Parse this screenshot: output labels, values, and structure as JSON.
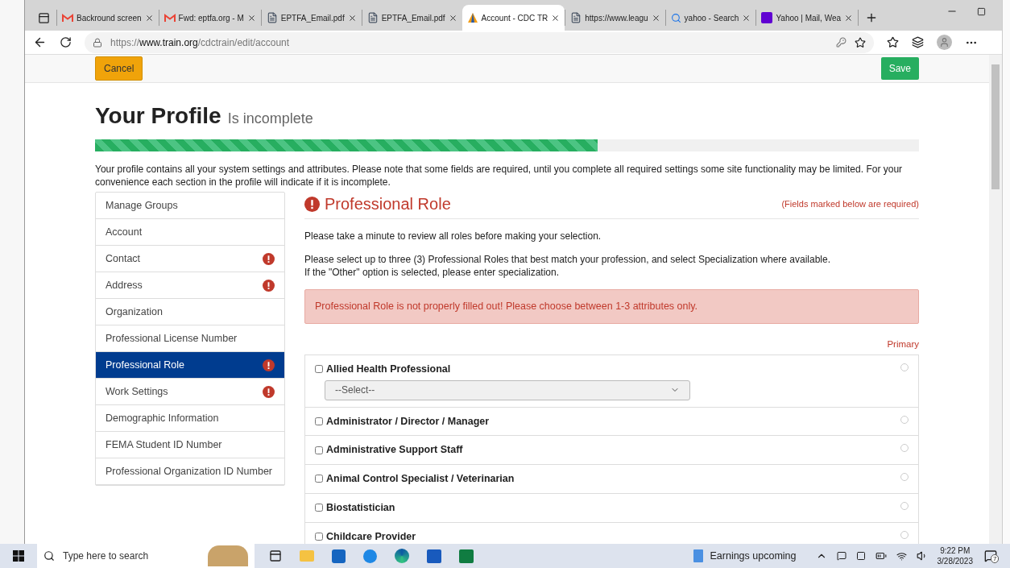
{
  "browser": {
    "tabs": [
      {
        "title": "Backround screen",
        "kind": "gmail",
        "selected": false
      },
      {
        "title": "Fwd: eptfa.org - M",
        "kind": "gmail",
        "selected": false
      },
      {
        "title": "EPTFA_Email.pdf",
        "kind": "doc",
        "selected": false
      },
      {
        "title": "EPTFA_Email.pdf",
        "kind": "doc",
        "selected": false
      },
      {
        "title": "Account - CDC TR",
        "kind": "cdc",
        "selected": true
      },
      {
        "title": "https://www.leagu",
        "kind": "doc",
        "selected": false
      },
      {
        "title": "yahoo - Search",
        "kind": "search",
        "selected": false
      },
      {
        "title": "Yahoo | Mail, Wea",
        "kind": "yahoo",
        "selected": false
      }
    ],
    "url": {
      "scheme": "https://",
      "host": "www.train.org",
      "path": "/cdctrain/edit/account"
    }
  },
  "page": {
    "cancel": "Cancel",
    "save": "Save",
    "title": "Your Profile",
    "status": "Is incomplete",
    "progress": {
      "level": 0.61
    },
    "intro": "Your profile contains all your system settings and attributes. Please note that some fields are required, until you complete all required settings some site functionality may be limited. For your convenience each section in the profile will indicate if it is incomplete.",
    "sidebar": [
      {
        "label": "Manage Groups",
        "alert": false,
        "selected": false
      },
      {
        "label": "Account",
        "alert": false,
        "selected": false
      },
      {
        "label": "Contact",
        "alert": true,
        "selected": false
      },
      {
        "label": "Address",
        "alert": true,
        "selected": false
      },
      {
        "label": "Organization",
        "alert": false,
        "selected": false
      },
      {
        "label": "Professional License Number",
        "alert": false,
        "selected": false
      },
      {
        "label": "Professional Role",
        "alert": true,
        "selected": true
      },
      {
        "label": "Work Settings",
        "alert": true,
        "selected": false
      },
      {
        "label": "Demographic Information",
        "alert": false,
        "selected": false
      },
      {
        "label": "FEMA Student ID Number",
        "alert": false,
        "selected": false
      },
      {
        "label": "Professional Organization ID Number",
        "alert": false,
        "selected": false
      }
    ],
    "section": {
      "title": "Professional Role",
      "required_note": "(Fields marked below are required)",
      "instructions": [
        "Please take a minute to review all roles before making your selection.",
        "Please select up to three (3) Professional Roles that best match your profession, and select Specialization where available.\nIf the \"Other\" option is selected, please enter specialization."
      ],
      "error": "Professional Role is not properly filled out! Please choose between 1-3 attributes only.",
      "primary_label": "Primary",
      "roles": [
        {
          "label": "Allied Health Professional",
          "checked": false,
          "primary": false,
          "select": "--Select--"
        },
        {
          "label": "Administrator / Director / Manager",
          "checked": false,
          "primary": false
        },
        {
          "label": "Administrative Support Staff",
          "checked": false,
          "primary": false
        },
        {
          "label": "Animal Control Specialist / Veterinarian",
          "checked": false,
          "primary": false
        },
        {
          "label": "Biostatistician",
          "checked": false,
          "primary": false
        },
        {
          "label": "Childcare Provider",
          "checked": false,
          "primary": false
        }
      ]
    }
  },
  "taskbar": {
    "search_placeholder": "Type here to search",
    "news": "Earnings upcoming",
    "time": "9:22 PM",
    "date": "3/28/2023",
    "notifications": "7"
  }
}
